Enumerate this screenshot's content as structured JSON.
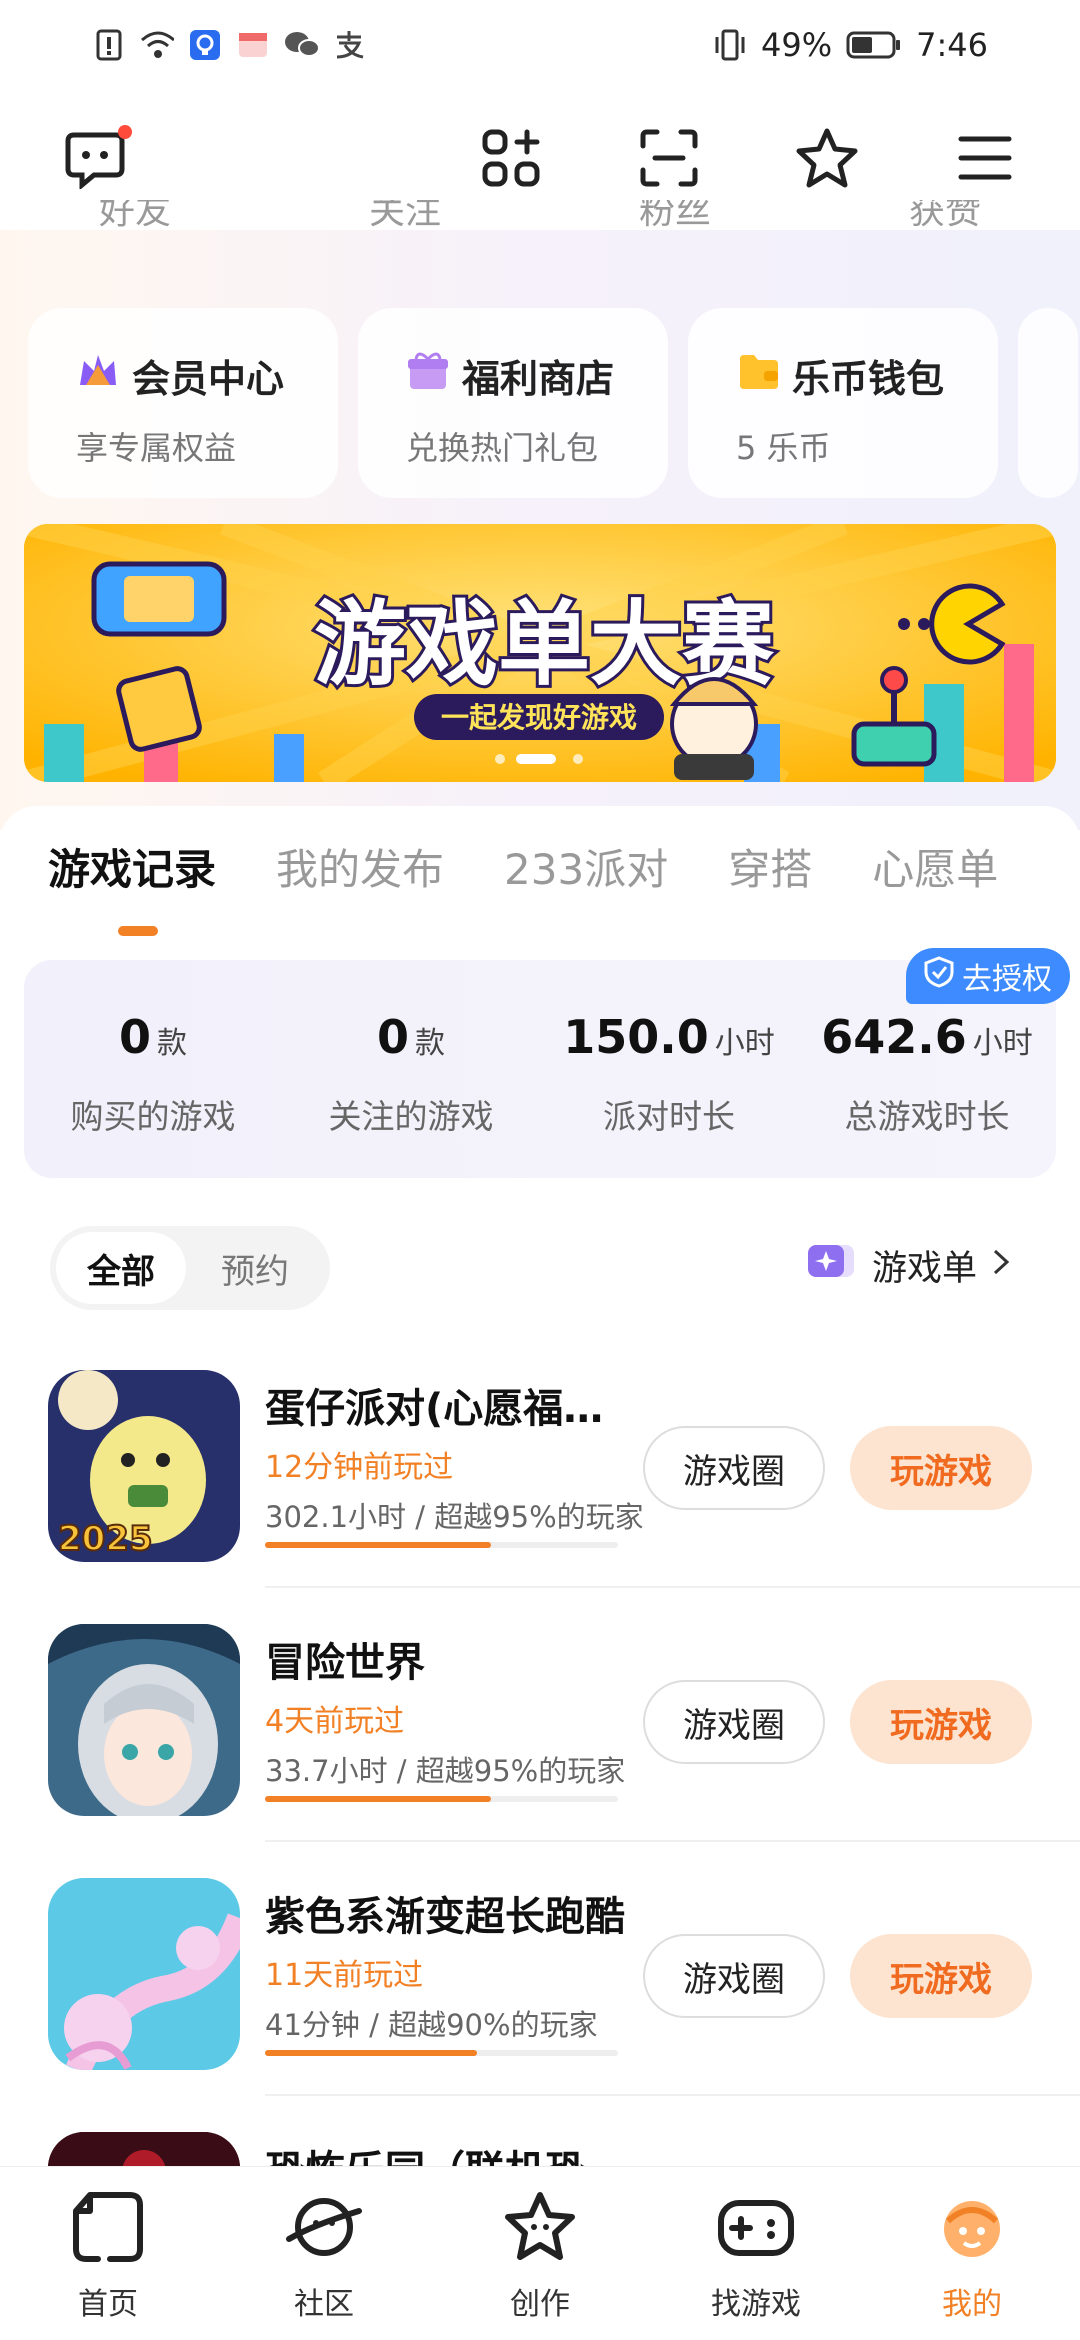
{
  "status_bar": {
    "battery": "49%",
    "time": "7:46"
  },
  "top_tabs_cut": [
    "好友",
    "关注",
    "粉丝",
    "获赞"
  ],
  "cards": [
    {
      "title": "会员中心",
      "subtitle": "享专属权益",
      "icon": "crown-icon"
    },
    {
      "title": "福利商店",
      "subtitle": "兑换热门礼包",
      "icon": "gift-icon"
    },
    {
      "title": "乐币钱包",
      "subtitle": "5 乐币",
      "icon": "wallet-icon"
    }
  ],
  "banner": {
    "title": "游戏单大赛",
    "subtitle": "一起发现好游戏",
    "colors": {
      "bg": "#ffc52c",
      "text": "#ffffff",
      "stroke": "#2b1a5c"
    }
  },
  "tabs": [
    "游戏记录",
    "我的发布",
    "233派对",
    "穿搭",
    "心愿单"
  ],
  "auth_badge": "去授权",
  "stats": [
    {
      "value": "0",
      "unit": "款",
      "label": "购买的游戏"
    },
    {
      "value": "0",
      "unit": "款",
      "label": "关注的游戏"
    },
    {
      "value": "150.0",
      "unit": "小时",
      "label": "派对时长"
    },
    {
      "value": "642.6",
      "unit": "小时",
      "label": "总游戏时长"
    }
  ],
  "filter": {
    "all": "全部",
    "reserve": "预约",
    "gamelist": "游戏单"
  },
  "games": [
    {
      "name": "蛋仔派对(心愿福…",
      "ago": "12分钟前玩过",
      "stat": "302.1小时 / 超越95%的玩家",
      "progress": 0.64,
      "circle": "游戏圈",
      "play": "玩游戏",
      "icon": "eggy-party-icon",
      "icon_text": "2025"
    },
    {
      "name": "冒险世界",
      "ago": "4天前玩过",
      "stat": "33.7小时 / 超越95%的玩家",
      "progress": 0.64,
      "circle": "游戏圈",
      "play": "玩游戏",
      "icon": "adventure-world-icon"
    },
    {
      "name": "紫色系渐变超长跑酷",
      "ago": "11天前玩过",
      "stat": "41分钟 / 超越90%的玩家",
      "progress": 0.6,
      "circle": "游戏圈",
      "play": "玩游戏",
      "icon": "parkour-icon"
    },
    {
      "name": "恐怖乐园（联机恐",
      "icon": "horror-park-icon"
    }
  ],
  "nav": [
    {
      "label": "首页",
      "icon": "home-icon"
    },
    {
      "label": "社区",
      "icon": "community-icon"
    },
    {
      "label": "创作",
      "icon": "create-icon"
    },
    {
      "label": "找游戏",
      "icon": "gamepad-icon"
    },
    {
      "label": "我的",
      "icon": "profile-icon"
    }
  ],
  "colors": {
    "accent": "#f28025",
    "auth_blue": "#3d8bff"
  }
}
